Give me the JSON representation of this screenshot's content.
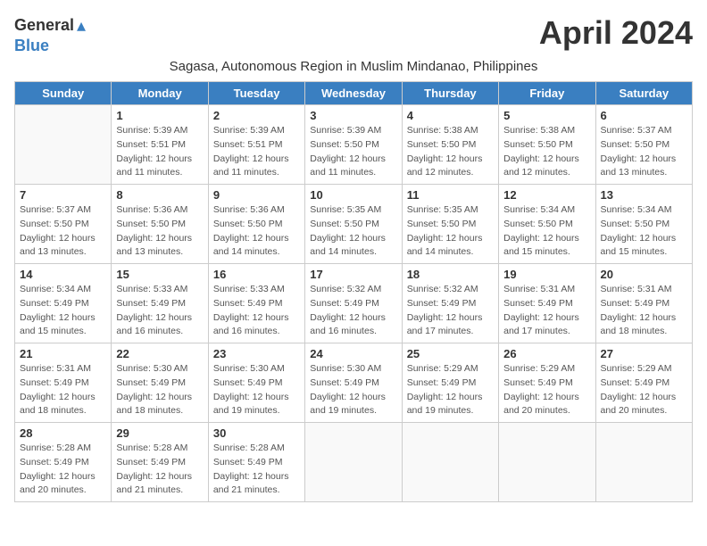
{
  "header": {
    "logo_general": "General",
    "logo_blue": "Blue",
    "month_title": "April 2024",
    "subtitle": "Sagasa, Autonomous Region in Muslim Mindanao, Philippines"
  },
  "weekdays": [
    "Sunday",
    "Monday",
    "Tuesday",
    "Wednesday",
    "Thursday",
    "Friday",
    "Saturday"
  ],
  "weeks": [
    [
      {
        "day": "",
        "info": ""
      },
      {
        "day": "1",
        "info": "Sunrise: 5:39 AM\nSunset: 5:51 PM\nDaylight: 12 hours\nand 11 minutes."
      },
      {
        "day": "2",
        "info": "Sunrise: 5:39 AM\nSunset: 5:51 PM\nDaylight: 12 hours\nand 11 minutes."
      },
      {
        "day": "3",
        "info": "Sunrise: 5:39 AM\nSunset: 5:50 PM\nDaylight: 12 hours\nand 11 minutes."
      },
      {
        "day": "4",
        "info": "Sunrise: 5:38 AM\nSunset: 5:50 PM\nDaylight: 12 hours\nand 12 minutes."
      },
      {
        "day": "5",
        "info": "Sunrise: 5:38 AM\nSunset: 5:50 PM\nDaylight: 12 hours\nand 12 minutes."
      },
      {
        "day": "6",
        "info": "Sunrise: 5:37 AM\nSunset: 5:50 PM\nDaylight: 12 hours\nand 13 minutes."
      }
    ],
    [
      {
        "day": "7",
        "info": "Sunrise: 5:37 AM\nSunset: 5:50 PM\nDaylight: 12 hours\nand 13 minutes."
      },
      {
        "day": "8",
        "info": "Sunrise: 5:36 AM\nSunset: 5:50 PM\nDaylight: 12 hours\nand 13 minutes."
      },
      {
        "day": "9",
        "info": "Sunrise: 5:36 AM\nSunset: 5:50 PM\nDaylight: 12 hours\nand 14 minutes."
      },
      {
        "day": "10",
        "info": "Sunrise: 5:35 AM\nSunset: 5:50 PM\nDaylight: 12 hours\nand 14 minutes."
      },
      {
        "day": "11",
        "info": "Sunrise: 5:35 AM\nSunset: 5:50 PM\nDaylight: 12 hours\nand 14 minutes."
      },
      {
        "day": "12",
        "info": "Sunrise: 5:34 AM\nSunset: 5:50 PM\nDaylight: 12 hours\nand 15 minutes."
      },
      {
        "day": "13",
        "info": "Sunrise: 5:34 AM\nSunset: 5:50 PM\nDaylight: 12 hours\nand 15 minutes."
      }
    ],
    [
      {
        "day": "14",
        "info": "Sunrise: 5:34 AM\nSunset: 5:49 PM\nDaylight: 12 hours\nand 15 minutes."
      },
      {
        "day": "15",
        "info": "Sunrise: 5:33 AM\nSunset: 5:49 PM\nDaylight: 12 hours\nand 16 minutes."
      },
      {
        "day": "16",
        "info": "Sunrise: 5:33 AM\nSunset: 5:49 PM\nDaylight: 12 hours\nand 16 minutes."
      },
      {
        "day": "17",
        "info": "Sunrise: 5:32 AM\nSunset: 5:49 PM\nDaylight: 12 hours\nand 16 minutes."
      },
      {
        "day": "18",
        "info": "Sunrise: 5:32 AM\nSunset: 5:49 PM\nDaylight: 12 hours\nand 17 minutes."
      },
      {
        "day": "19",
        "info": "Sunrise: 5:31 AM\nSunset: 5:49 PM\nDaylight: 12 hours\nand 17 minutes."
      },
      {
        "day": "20",
        "info": "Sunrise: 5:31 AM\nSunset: 5:49 PM\nDaylight: 12 hours\nand 18 minutes."
      }
    ],
    [
      {
        "day": "21",
        "info": "Sunrise: 5:31 AM\nSunset: 5:49 PM\nDaylight: 12 hours\nand 18 minutes."
      },
      {
        "day": "22",
        "info": "Sunrise: 5:30 AM\nSunset: 5:49 PM\nDaylight: 12 hours\nand 18 minutes."
      },
      {
        "day": "23",
        "info": "Sunrise: 5:30 AM\nSunset: 5:49 PM\nDaylight: 12 hours\nand 19 minutes."
      },
      {
        "day": "24",
        "info": "Sunrise: 5:30 AM\nSunset: 5:49 PM\nDaylight: 12 hours\nand 19 minutes."
      },
      {
        "day": "25",
        "info": "Sunrise: 5:29 AM\nSunset: 5:49 PM\nDaylight: 12 hours\nand 19 minutes."
      },
      {
        "day": "26",
        "info": "Sunrise: 5:29 AM\nSunset: 5:49 PM\nDaylight: 12 hours\nand 20 minutes."
      },
      {
        "day": "27",
        "info": "Sunrise: 5:29 AM\nSunset: 5:49 PM\nDaylight: 12 hours\nand 20 minutes."
      }
    ],
    [
      {
        "day": "28",
        "info": "Sunrise: 5:28 AM\nSunset: 5:49 PM\nDaylight: 12 hours\nand 20 minutes."
      },
      {
        "day": "29",
        "info": "Sunrise: 5:28 AM\nSunset: 5:49 PM\nDaylight: 12 hours\nand 21 minutes."
      },
      {
        "day": "30",
        "info": "Sunrise: 5:28 AM\nSunset: 5:49 PM\nDaylight: 12 hours\nand 21 minutes."
      },
      {
        "day": "",
        "info": ""
      },
      {
        "day": "",
        "info": ""
      },
      {
        "day": "",
        "info": ""
      },
      {
        "day": "",
        "info": ""
      }
    ]
  ]
}
